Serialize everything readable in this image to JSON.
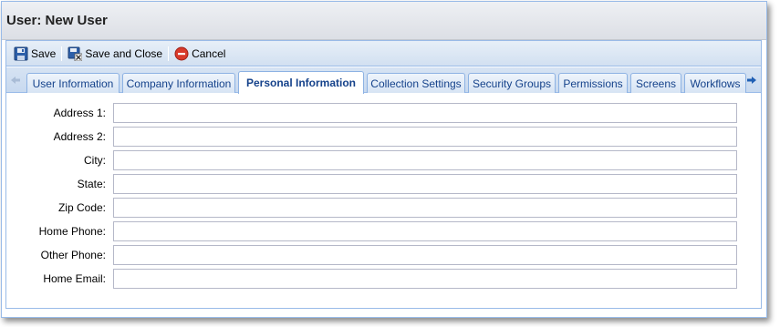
{
  "window": {
    "title": "User: New User"
  },
  "toolbar": {
    "save_label": "Save",
    "save_close_label": "Save and Close",
    "cancel_label": "Cancel"
  },
  "tabs": [
    {
      "label": "User Information",
      "active": false
    },
    {
      "label": "Company Information",
      "active": false
    },
    {
      "label": "Personal Information",
      "active": true
    },
    {
      "label": "Collection Settings",
      "active": false
    },
    {
      "label": "Security Groups",
      "active": false
    },
    {
      "label": "Permissions",
      "active": false
    },
    {
      "label": "Screens",
      "active": false
    },
    {
      "label": "Workflows",
      "active": false
    }
  ],
  "form": {
    "fields": [
      {
        "label": "Address 1:",
        "value": ""
      },
      {
        "label": "Address 2:",
        "value": ""
      },
      {
        "label": "City:",
        "value": ""
      },
      {
        "label": "State:",
        "value": ""
      },
      {
        "label": "Zip Code:",
        "value": ""
      },
      {
        "label": "Home Phone:",
        "value": ""
      },
      {
        "label": "Other Phone:",
        "value": ""
      },
      {
        "label": "Home Email:",
        "value": ""
      }
    ]
  },
  "icons": {
    "save": "floppy-disk-icon",
    "save_close": "floppy-disk-close-icon",
    "cancel": "red-circle-minus-icon",
    "scroll_left": "arrow-left-icon",
    "scroll_right": "arrow-right-icon"
  },
  "colors": {
    "tab_text": "#15428b",
    "border": "#99bbe8",
    "scroll_right_arrow": "#1f5fb4",
    "cancel_red": "#d93a2b"
  }
}
